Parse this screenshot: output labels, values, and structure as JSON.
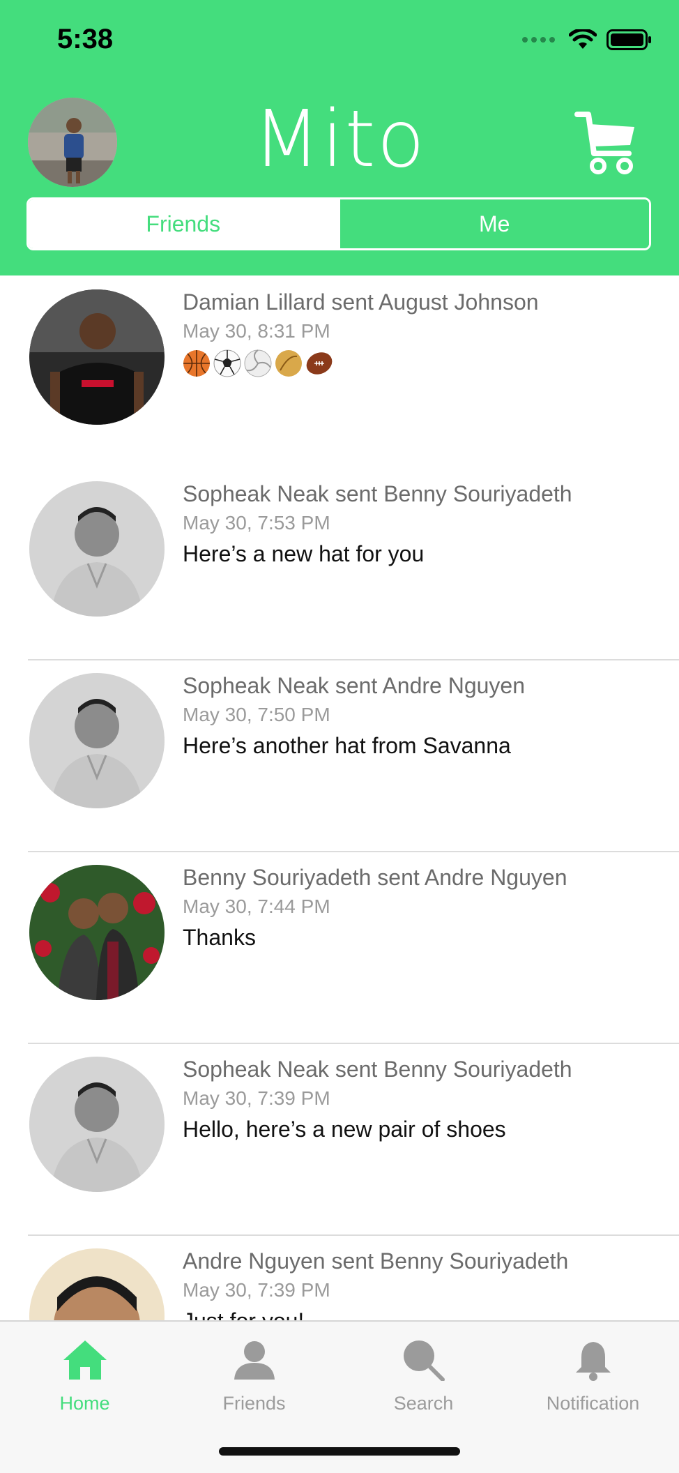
{
  "status_bar": {
    "time": "5:38"
  },
  "header": {
    "app_title": "Mito",
    "cart_icon": "cart-icon",
    "segments": [
      {
        "label": "Friends",
        "selected": true
      },
      {
        "label": "Me",
        "selected": false
      }
    ],
    "accent_color": "#44dd7d"
  },
  "feed": [
    {
      "title": "Damian Lillard sent August Johnson",
      "time": "May 30, 8:31 PM",
      "message": "",
      "emoji_icons": [
        "basketball-icon",
        "soccer-ball-icon",
        "volleyball-icon",
        "football-icon",
        "american-football-icon"
      ]
    },
    {
      "title": "Sopheak Neak sent Benny Souriyadeth",
      "time": "May 30, 7:53 PM",
      "message": "Here’s a new hat for you"
    },
    {
      "title": "Sopheak Neak sent Andre Nguyen",
      "time": "May 30, 7:50 PM",
      "message": "Here’s another  hat from Savanna"
    },
    {
      "title": "Benny Souriyadeth sent Andre Nguyen",
      "time": "May 30, 7:44 PM",
      "message": "Thanks"
    },
    {
      "title": "Sopheak Neak sent Benny Souriyadeth",
      "time": "May 30, 7:39 PM",
      "message": "Hello, here’s a new pair of shoes"
    },
    {
      "title": "Andre Nguyen sent Benny Souriyadeth",
      "time": "May 30, 7:39 PM",
      "message": "Just for you!"
    }
  ],
  "tab_bar": {
    "active": "Home",
    "tabs": [
      {
        "label": "Home"
      },
      {
        "label": "Friends"
      },
      {
        "label": "Search"
      },
      {
        "label": "Notification"
      }
    ],
    "active_color": "#44dd7d",
    "inactive_color": "#9b9b9b"
  }
}
